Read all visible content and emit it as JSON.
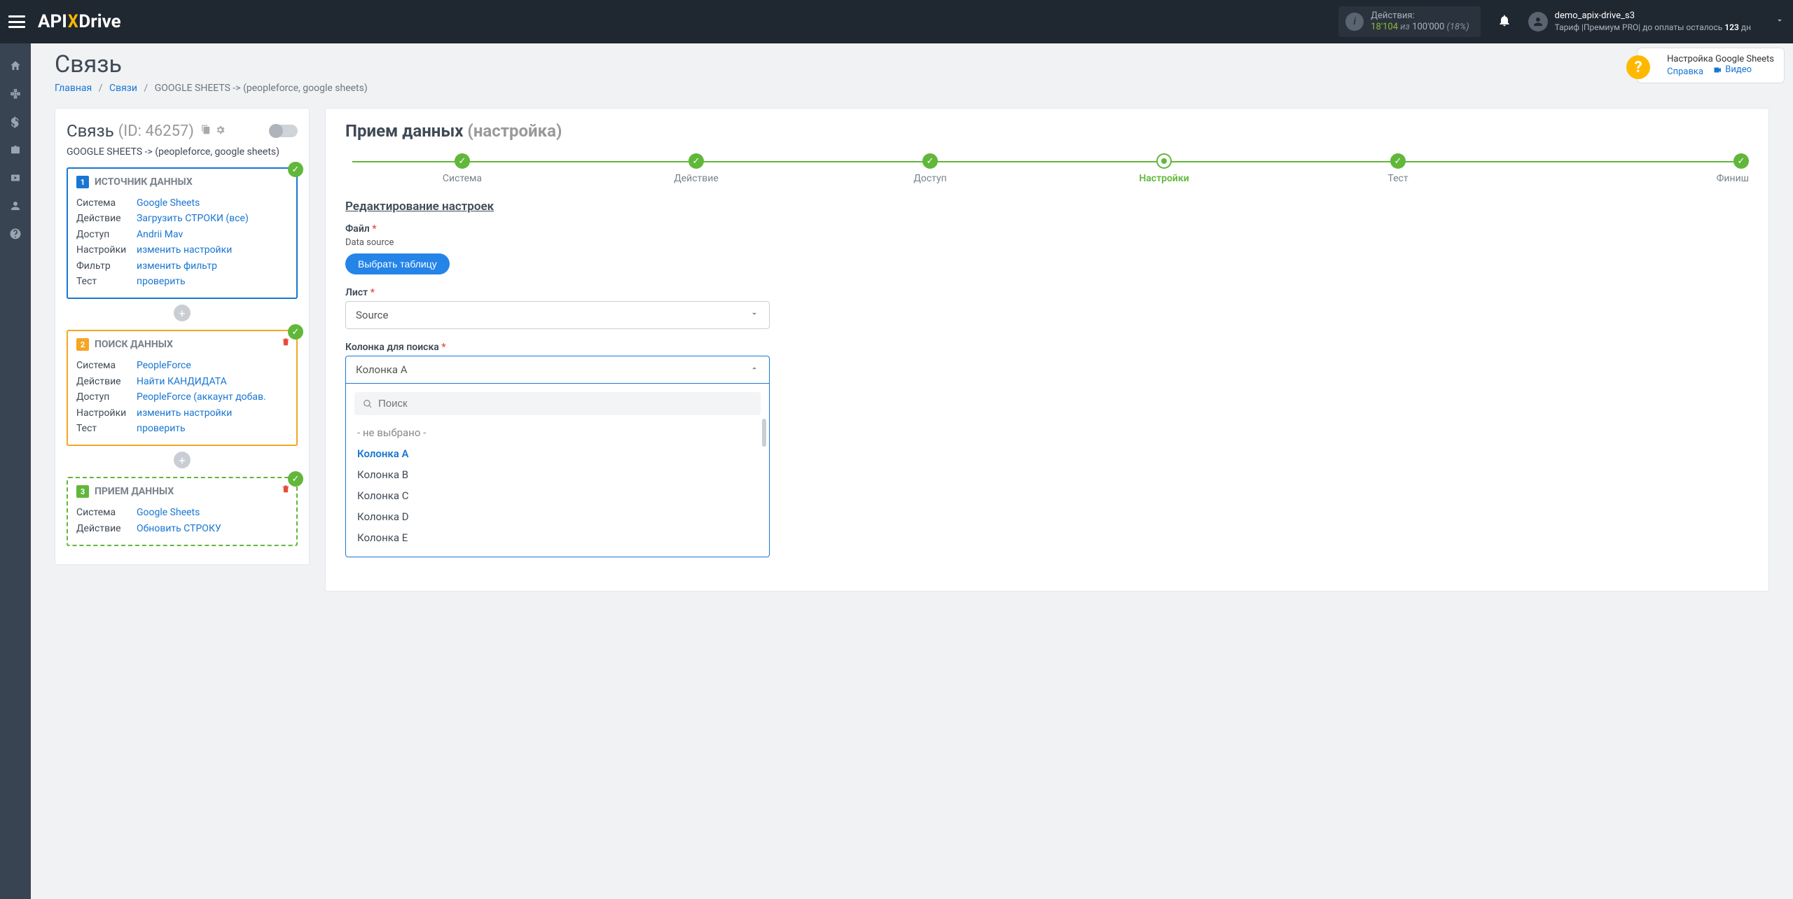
{
  "topbar": {
    "logo_a": "API",
    "logo_x": "X",
    "logo_b": "Drive",
    "actions_label": "Действия:",
    "actions_num": "18'104",
    "actions_of": "из",
    "actions_limit": "100'000",
    "actions_pct": "(18%)",
    "user": "demo_apix-drive_s3",
    "tariff": "Тариф |Премиум PRO| до оплаты осталось ",
    "days_num": "123",
    "days_unit": " дн"
  },
  "help": {
    "title": "Настройка Google Sheets",
    "link1": "Справка",
    "link2": "Видео"
  },
  "page_title": "Связь",
  "breadcrumb": {
    "home": "Главная",
    "links": "Связи",
    "current": "GOOGLE SHEETS -> (peopleforce, google sheets)"
  },
  "conn": {
    "title": "Связь",
    "id": "(ID: 46257)",
    "subtitle": "GOOGLE SHEETS -> (peopleforce, google sheets)"
  },
  "labels": {
    "system": "Система",
    "action": "Действие",
    "access": "Доступ",
    "settings": "Настройки",
    "filter": "Фильтр",
    "test": "Тест"
  },
  "card1": {
    "title": "ИСТОЧНИК ДАННЫХ",
    "system": "Google Sheets",
    "action": "Загрузить СТРОКИ (все)",
    "access": "Andrii Mav",
    "settings": "изменить настройки",
    "filter": "изменить фильтр",
    "test": "проверить"
  },
  "card2": {
    "title": "ПОИСК ДАННЫХ",
    "system": "PeopleForce",
    "action": "Найти КАНДИДАТА",
    "access": "PeopleForce (аккаунт добав.",
    "settings": "изменить настройки",
    "test": "проверить"
  },
  "card3": {
    "title": "ПРИЕМ ДАННЫХ",
    "system": "Google Sheets",
    "action": "Обновить СТРОКУ"
  },
  "right": {
    "title": "Прием данных",
    "sub": "(настройка)"
  },
  "steps": [
    "Система",
    "Действие",
    "Доступ",
    "Настройки",
    "Тест",
    "Финиш"
  ],
  "section_title": "Редактирование настроек",
  "file_field": {
    "label": "Файл",
    "sub": "Data source",
    "btn": "Выбрать таблицу"
  },
  "sheet_field": {
    "label": "Лист",
    "value": "Source"
  },
  "col_field": {
    "label": "Колонка для поиска",
    "value": "Колонка A",
    "search_ph": "Поиск",
    "options": [
      "- не выбрано -",
      "Колонка A",
      "Колонка B",
      "Колонка C",
      "Колонка D",
      "Колонка E"
    ]
  }
}
